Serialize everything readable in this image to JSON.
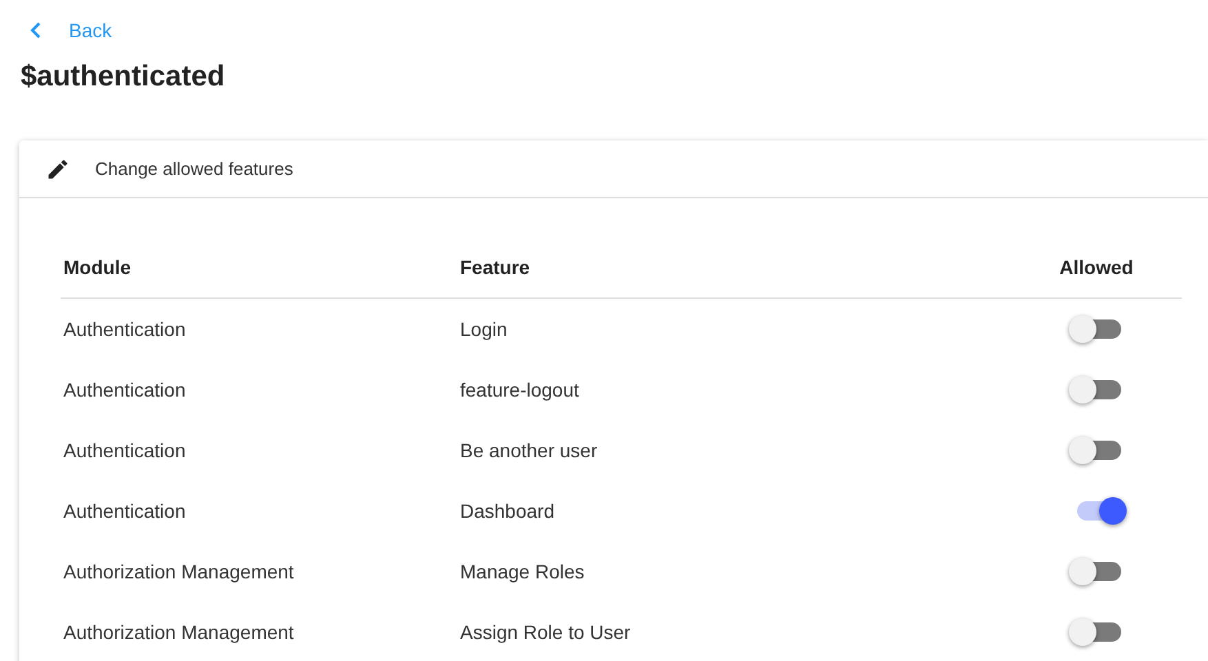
{
  "back_link": {
    "label": "Back"
  },
  "title": "$authenticated",
  "card": {
    "header": "Change allowed features",
    "table": {
      "columns": [
        "Module",
        "Feature",
        "Allowed"
      ],
      "rows": [
        {
          "module": "Authentication",
          "feature": "Login",
          "allowed": false
        },
        {
          "module": "Authentication",
          "feature": "feature-logout",
          "allowed": false
        },
        {
          "module": "Authentication",
          "feature": "Be another user",
          "allowed": false
        },
        {
          "module": "Authentication",
          "feature": "Dashboard",
          "allowed": true
        },
        {
          "module": "Authorization Management",
          "feature": "Manage Roles",
          "allowed": false
        },
        {
          "module": "Authorization Management",
          "feature": "Assign Role to User",
          "allowed": false
        }
      ]
    }
  }
}
